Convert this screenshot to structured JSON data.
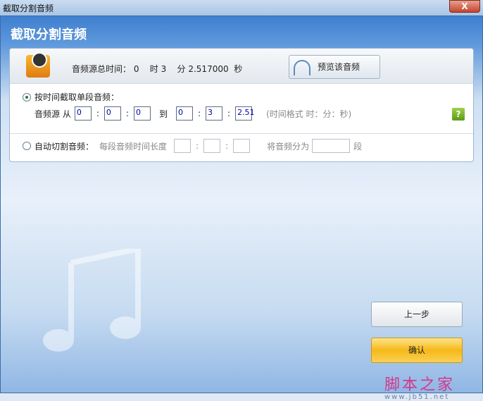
{
  "window": {
    "title": "截取分割音频",
    "close_label": "X"
  },
  "header": {
    "title": "截取分割音频"
  },
  "info": {
    "total_label": "音频源总时间：",
    "hours": "0",
    "hours_unit": "时",
    "minutes": "3",
    "minutes_unit": "分",
    "seconds": "2.517000",
    "seconds_unit": "秒",
    "preview_label": "预览该音频"
  },
  "single": {
    "label": "按时间截取单段音频：",
    "source_label": "音频源",
    "from_label": "从",
    "to_label": "到",
    "from": [
      "0",
      "0",
      "0"
    ],
    "to": [
      "0",
      "3",
      "2.51"
    ],
    "colon": ":",
    "hint": "(时间格式 时：分：秒)",
    "help": "?"
  },
  "auto": {
    "label": "自动切割音频：",
    "length_label": "每段音频时间长度",
    "split_label": "将音频分为",
    "segment_unit": "段"
  },
  "buttons": {
    "back": "上一步",
    "confirm": "确认"
  },
  "watermark": {
    "text": "脚本之家",
    "url": "www.jb51.net"
  }
}
